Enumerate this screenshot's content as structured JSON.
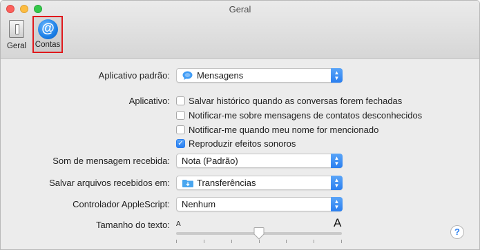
{
  "window": {
    "title": "Geral"
  },
  "tabs": [
    {
      "label": "Geral",
      "icon": "switch-icon"
    },
    {
      "label": "Contas",
      "icon": "at-icon"
    }
  ],
  "settings": {
    "default_app": {
      "label": "Aplicativo padrão:",
      "value": "Mensagens",
      "icon": "messages-icon"
    },
    "app": {
      "label": "Aplicativo:",
      "options": [
        {
          "text": "Salvar histórico quando as conversas forem fechadas",
          "checked": false
        },
        {
          "text": "Notificar-me sobre mensagens de contatos desconhecidos",
          "checked": false
        },
        {
          "text": "Notificar-me quando meu nome for mencionado",
          "checked": false
        },
        {
          "text": "Reproduzir efeitos sonoros",
          "checked": true
        }
      ]
    },
    "sound": {
      "label": "Som de mensagem recebida:",
      "value": "Nota (Padrão)"
    },
    "save_files": {
      "label": "Salvar arquivos recebidos em:",
      "value": "Transferências",
      "icon": "folder-icon"
    },
    "applescript": {
      "label": "Controlador AppleScript:",
      "value": "Nenhum"
    },
    "text_size": {
      "label": "Tamanho do texto:",
      "min_label": "A",
      "max_label": "A",
      "value_fraction": 0.5,
      "ticks": 7
    }
  },
  "help": {
    "symbol": "?"
  },
  "colors": {
    "accent": "#2a7ff0",
    "highlight_border": "#e0191c"
  }
}
